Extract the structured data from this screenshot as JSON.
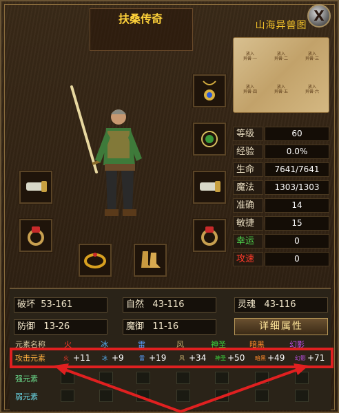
{
  "title": "扶桑传奇",
  "map": {
    "title": "山海异兽图",
    "slots": [
      {
        "top": "放入",
        "bottom": "异兽·一"
      },
      {
        "top": "放入",
        "bottom": "异兽·二"
      },
      {
        "top": "放入",
        "bottom": "异兽·三"
      },
      {
        "top": "放入",
        "bottom": "异兽·四"
      },
      {
        "top": "放入",
        "bottom": "异兽·五"
      },
      {
        "top": "放入",
        "bottom": "异兽·六"
      }
    ]
  },
  "close_label": "X",
  "stats": [
    {
      "label": "等级",
      "value": "60",
      "style": "normal"
    },
    {
      "label": "经验",
      "value": "0.0%",
      "style": "normal"
    },
    {
      "label": "生命",
      "value": "7641/7641",
      "style": "normal"
    },
    {
      "label": "魔法",
      "value": "1303/1303",
      "style": "normal"
    },
    {
      "label": "准确",
      "value": "14",
      "style": "normal"
    },
    {
      "label": "敏捷",
      "value": "15",
      "style": "normal"
    },
    {
      "label": "幸运",
      "value": "0",
      "style": "green"
    },
    {
      "label": "攻速",
      "value": "0",
      "style": "red"
    }
  ],
  "attributes": {
    "pohuai": {
      "label": "破坏",
      "value": "53-161"
    },
    "ziran": {
      "label": "自然",
      "value": "43-116"
    },
    "linghun": {
      "label": "灵魂",
      "value": "43-116"
    },
    "fangyu": {
      "label": "防御",
      "value": "13-26"
    },
    "moyu": {
      "label": "魔御",
      "value": "11-16"
    },
    "detail_button": "详细属性"
  },
  "elements": {
    "header_label": "元素名称",
    "names": [
      "火",
      "冰",
      "雷",
      "风",
      "神圣",
      "暗黑",
      "幻影"
    ],
    "rows": [
      {
        "label": "攻击元素",
        "values": [
          "+11",
          "+9",
          "+19",
          "+34",
          "+50",
          "+49",
          "+71"
        ]
      },
      {
        "label": "强元素"
      },
      {
        "label": "弱元素"
      }
    ]
  },
  "colors": {
    "fire": "#ff3a2a",
    "ice": "#5ab8ff",
    "thunder": "#5aa0ff",
    "wind": "#c8b070",
    "holy": "#3ed83e",
    "dark": "#ff8a2a",
    "phantom": "#c050e8",
    "highlight": "#e02020"
  }
}
